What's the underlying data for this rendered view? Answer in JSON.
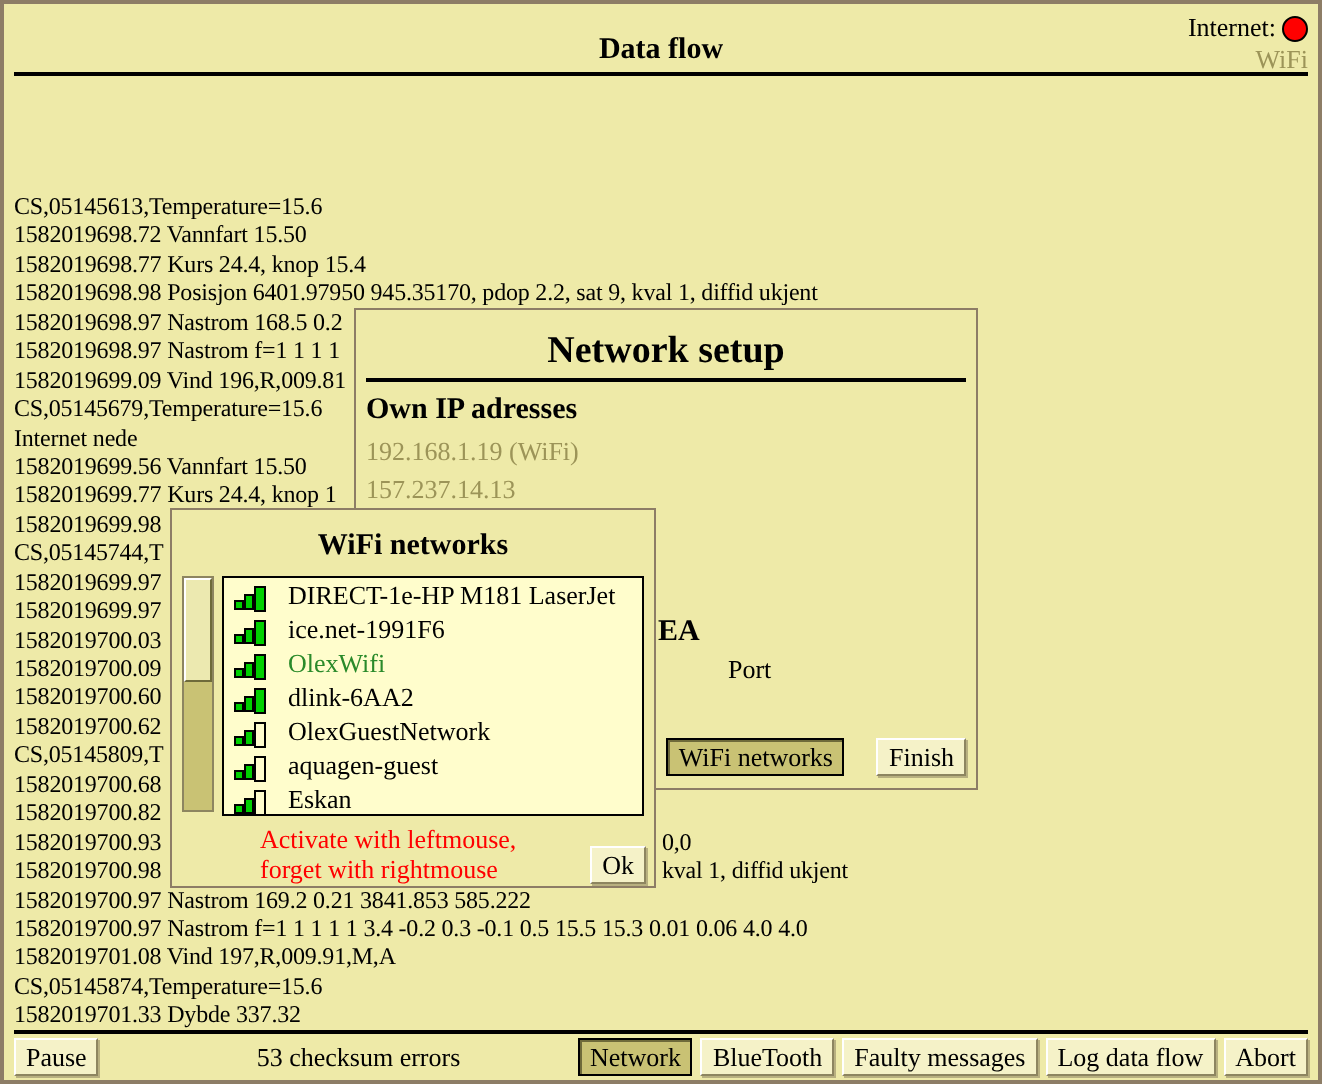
{
  "window": {
    "title": "Data flow"
  },
  "internet": {
    "label": "Internet:",
    "connected": false
  },
  "wifi_indicator": {
    "text": "WiFi",
    "active": false
  },
  "log": [
    {
      "text": "CS,05145613,Temperature=15.6"
    },
    {
      "text": "1582019698.72 Vannfart 15.50"
    },
    {
      "text": "1582019698.77 Kurs 24.4, knop 15.4"
    },
    {
      "text": "1582019698.98 Posisjon 6401.97950 945.35170, pdop 2.2, sat 9, kval 1, diffid ukjent"
    },
    {
      "text": "1582019698.97 Nastrom 168.5 0.2"
    },
    {
      "text": "1582019698.97 Nastrom f=1 1 1 1"
    },
    {
      "text": "1582019699.09 Vind 196,R,009.81"
    },
    {
      "text": "CS,05145679,Temperature=15.6"
    },
    {
      "text": "Internet nede"
    },
    {
      "text": "1582019699.56 Vannfart 15.50"
    },
    {
      "text": "1582019699.77 Kurs 24.4, knop 1"
    },
    {
      "text": "1582019699.98"
    },
    {
      "text": "CS,05145744,T"
    },
    {
      "text": "1582019699.97"
    },
    {
      "text": "1582019699.97"
    },
    {
      "text": "1582019700.03"
    },
    {
      "text": "1582019700.09"
    },
    {
      "text": "1582019700.60"
    },
    {
      "text": "1582019700.62"
    },
    {
      "text": "CS,05145809,T"
    },
    {
      "text": "1582019700.68"
    },
    {
      "text": "1582019700.82"
    },
    {
      "text": "1582019700.93",
      "tail": "0,0"
    },
    {
      "text": "1582019700.98",
      "tail": "kval 1, diffid ukjent"
    },
    {
      "text": "1582019700.97 Nastrom 169.2 0.21 3841.853 585.222"
    },
    {
      "text": "1582019700.97 Nastrom f=1 1 1 1 1 3.4 -0.2 0.3 -0.1 0.5 15.5 15.3 0.01 0.06 4.0 4.0"
    },
    {
      "text": "1582019701.08 Vind 197,R,009.91,M,A"
    },
    {
      "text": "CS,05145874,Temperature=15.6"
    },
    {
      "text": "1582019701.33 Dybde 337.32"
    }
  ],
  "network_setup": {
    "title": "Network setup",
    "ip_heading": "Own IP adresses",
    "ip_addresses": [
      {
        "text": "192.168.1.19 (WiFi)",
        "disabled": true
      },
      {
        "text": "157.237.14.13",
        "disabled": true
      }
    ],
    "section_heading": "EA",
    "port_label": "Port",
    "buttons": [
      {
        "label": "WiFi networks",
        "pressed": true
      },
      {
        "label": "Finish",
        "pressed": false
      }
    ]
  },
  "wifi_networks": {
    "title": "WiFi networks",
    "networks": [
      {
        "name": "DIRECT-1e-HP M181 LaserJet",
        "kind": "strong",
        "connected": false
      },
      {
        "name": "ice.net-1991F6",
        "kind": "strong",
        "connected": false
      },
      {
        "name": "OlexWifi",
        "kind": "strong",
        "connected": true
      },
      {
        "name": "dlink-6AA2",
        "kind": "strong",
        "connected": false
      },
      {
        "name": "OlexGuestNetwork",
        "kind": "medium",
        "connected": false
      },
      {
        "name": "aquagen-guest",
        "kind": "medium",
        "connected": false
      },
      {
        "name": "Eskan",
        "kind": "medium",
        "connected": false
      }
    ],
    "hint": [
      "Activate with leftmouse,",
      "forget with rightmouse"
    ],
    "ok_button": "Ok"
  },
  "status_bar": {
    "pause_button": "Pause",
    "errors": "53 checksum errors",
    "buttons": [
      {
        "label": "Network",
        "pressed": true
      },
      {
        "label": "BlueTooth",
        "pressed": false
      },
      {
        "label": "Faulty messages",
        "pressed": false
      },
      {
        "label": "Log data flow",
        "pressed": false
      },
      {
        "label": "Abort",
        "pressed": false
      }
    ]
  }
}
